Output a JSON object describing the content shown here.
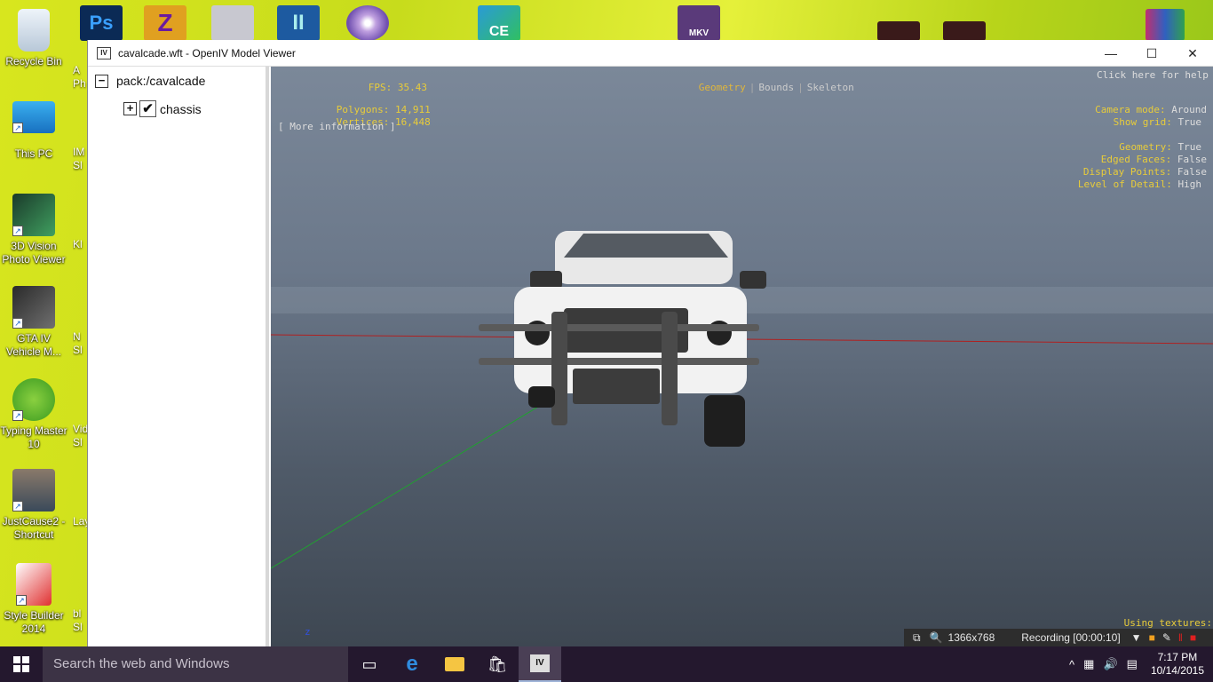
{
  "desktop": {
    "icons": [
      {
        "label": "Recycle Bin"
      },
      {
        "label": "This PC"
      },
      {
        "label": "3D Vision Photo Viewer"
      },
      {
        "label": "GTA IV Vehicle M..."
      },
      {
        "label": "Typing Master 10"
      },
      {
        "label": "JustCause2 - Shortcut"
      },
      {
        "label": "Style Builder 2014"
      }
    ],
    "partial_labels": [
      "A",
      "Ph",
      "IM",
      "Sl",
      "Kl",
      "N",
      "Sl",
      "Vide",
      "Sl",
      "Lay",
      "bl",
      "Sl"
    ],
    "top_icons": [
      {
        "text": "Ps"
      },
      {
        "text": "Z"
      },
      {
        "text": ""
      },
      {
        "text": "II"
      },
      {
        "text": ""
      },
      {
        "text": ""
      },
      {
        "text": "CE"
      },
      {
        "text": "MKV"
      }
    ]
  },
  "window": {
    "app_logo": "IV",
    "title": "cavalcade.wft - OpenIV Model Viewer",
    "minimize": "—",
    "maximize": "☐",
    "close": "✕"
  },
  "tree": {
    "root_toggle": "−",
    "root_label": "pack:/cavalcade",
    "child_toggle": "+",
    "child_check": "✔",
    "child_label": "chassis"
  },
  "viewport": {
    "fps_label": "FPS:",
    "fps_value": "35.43",
    "polygons_label": "Polygons:",
    "polygons_value": "14,911",
    "vertices_label": "Vertices:",
    "vertices_value": "16,448",
    "more_info": "[ More information ]",
    "mode_geometry": "Geometry",
    "mode_bounds": "Bounds",
    "mode_skeleton": "Skeleton",
    "mode_sep": "|",
    "help": "Click here for help",
    "camera_mode_label": "Camera mode:",
    "camera_mode_value": "Around",
    "show_grid_label": "Show grid:",
    "show_grid_value": "True",
    "geometry_label": "Geometry:",
    "geometry_value": "True",
    "edged_faces_label": "Edged Faces:",
    "edged_faces_value": "False",
    "display_points_label": "Display Points:",
    "display_points_value": "False",
    "lod_label": "Level of Detail:",
    "lod_value": "High",
    "using_textures": "Using textures:",
    "axis_z": "z"
  },
  "recorder": {
    "resolution": "1366x768",
    "recording": "Recording [00:00:10]"
  },
  "taskbar": {
    "search_placeholder": "Search the web and Windows",
    "time": "7:17 PM",
    "date": "10/14/2015"
  }
}
